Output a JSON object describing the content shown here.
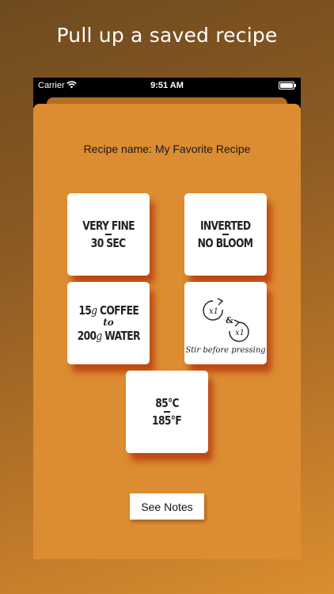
{
  "headline": "Pull up a saved recipe",
  "status_bar": {
    "carrier": "Carrier",
    "time": "9:51 AM"
  },
  "recipe": {
    "name_label": "Recipe name: My Favorite Recipe",
    "grind": {
      "size": "VERY FINE",
      "time": "30 SEC"
    },
    "method": {
      "orientation": "INVERTED",
      "bloom": "NO BLOOM"
    },
    "ratio": {
      "coffee_amount": "15",
      "coffee_unit": "g",
      "coffee_label": "COFFEE",
      "joiner": "to",
      "water_amount": "200",
      "water_unit": "g",
      "water_label": "WATER"
    },
    "stir": {
      "count_1": "x1",
      "joiner": "&",
      "count_2": "x1",
      "caption": "Stir before pressing"
    },
    "temperature": {
      "celsius": "85°C",
      "fahrenheit": "185°F"
    }
  },
  "actions": {
    "see_notes": "See Notes"
  }
}
